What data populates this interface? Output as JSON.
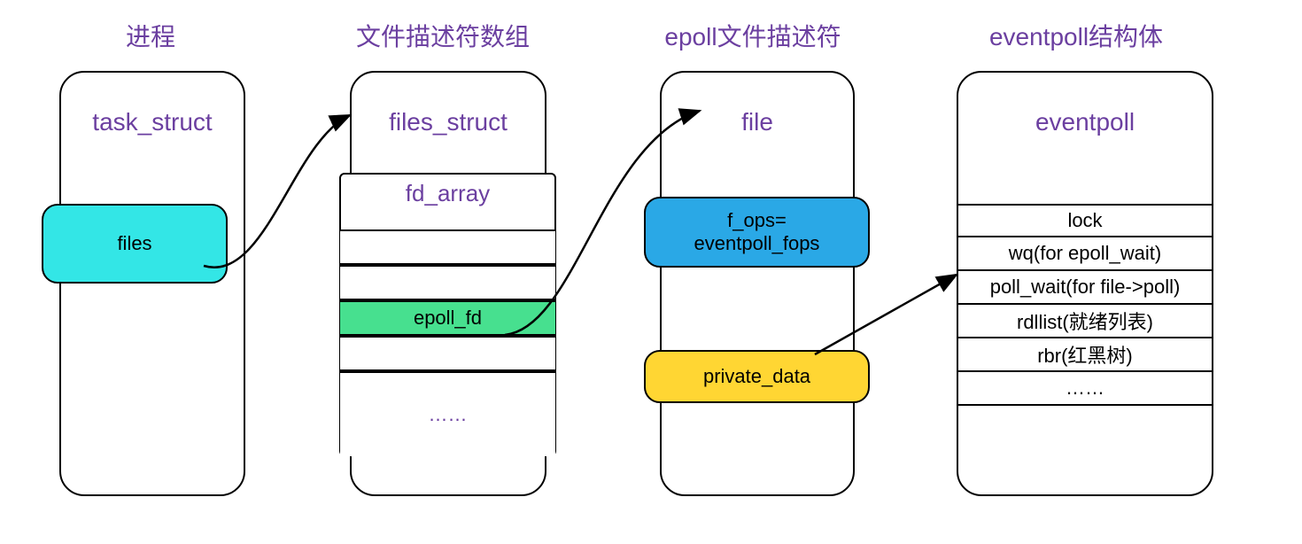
{
  "titles": {
    "process": "进程",
    "fd_array": "文件描述符数组",
    "epoll_fd": "epoll文件描述符",
    "eventpoll_struct": "eventpoll结构体"
  },
  "process": {
    "struct_name": "task_struct",
    "files_field": "files"
  },
  "files_struct": {
    "struct_name": "files_struct",
    "fd_array_label": "fd_array",
    "rows": {
      "empty1": "",
      "empty2": "",
      "epoll_fd": "epoll_fd",
      "empty3": "",
      "ellipsis": "……"
    }
  },
  "file": {
    "struct_name": "file",
    "f_ops_line1": "f_ops=",
    "f_ops_line2": "eventpoll_fops",
    "private_data": "private_data"
  },
  "eventpoll": {
    "struct_name": "eventpoll",
    "rows": {
      "lock": "lock",
      "wq": "wq(for epoll_wait)",
      "poll_wait": "poll_wait(for file->poll)",
      "rdllist": "rdllist(就绪列表)",
      "rbr": "rbr(红黑树)",
      "ellipsis": "……"
    }
  },
  "colors": {
    "cyan": "#33e6e6",
    "green": "#47e08f",
    "blue": "#2aa8e6",
    "yellow": "#ffd633",
    "purple": "#6b3fa0"
  }
}
